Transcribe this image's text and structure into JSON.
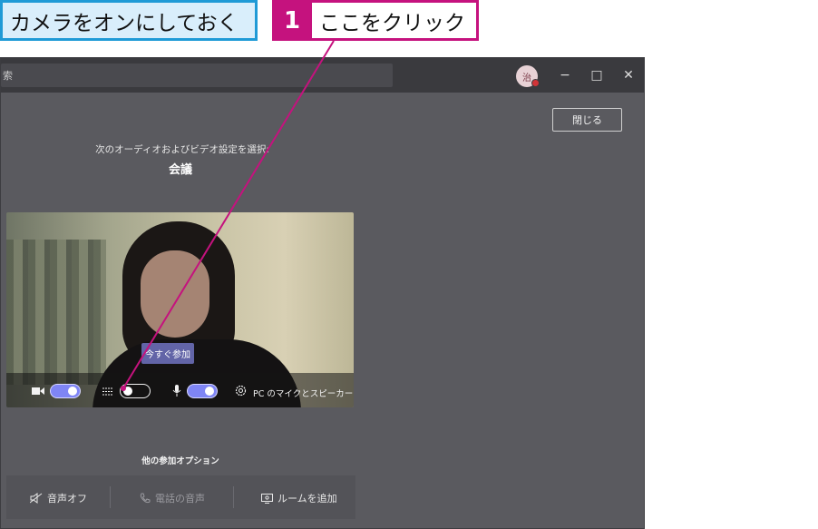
{
  "callouts": {
    "instruction": "カメラをオンにしておく",
    "step_number": "1",
    "step_text": "ここをクリック",
    "accent_blue": "#1f9ad6",
    "accent_magenta": "#c5127e"
  },
  "titlebar": {
    "search_placeholder": "索",
    "avatar_initial": "治",
    "minimize": "−",
    "maximize": "□",
    "close": "✕"
  },
  "dialog": {
    "close_button": "閉じる",
    "subtitle": "次のオーディオおよびビデオ設定を選択:",
    "meeting_title": "会議",
    "join_button": "今すぐ参加",
    "controls": {
      "camera_on": true,
      "background_blur_on": false,
      "mic_on": true,
      "device_label": "PC のマイクとスピーカー"
    },
    "other_options_title": "他の参加オプション",
    "options": [
      {
        "label": "音声オフ",
        "icon": "speaker-off-icon"
      },
      {
        "label": "電話の音声",
        "icon": "phone-icon"
      },
      {
        "label": "ルームを追加",
        "icon": "room-icon"
      }
    ]
  },
  "colors": {
    "window_bg": "#5a5a5f",
    "titlebar_bg": "#3a3a3e",
    "toggle_on": "#7f85f5",
    "join_button": "#6264a7"
  }
}
